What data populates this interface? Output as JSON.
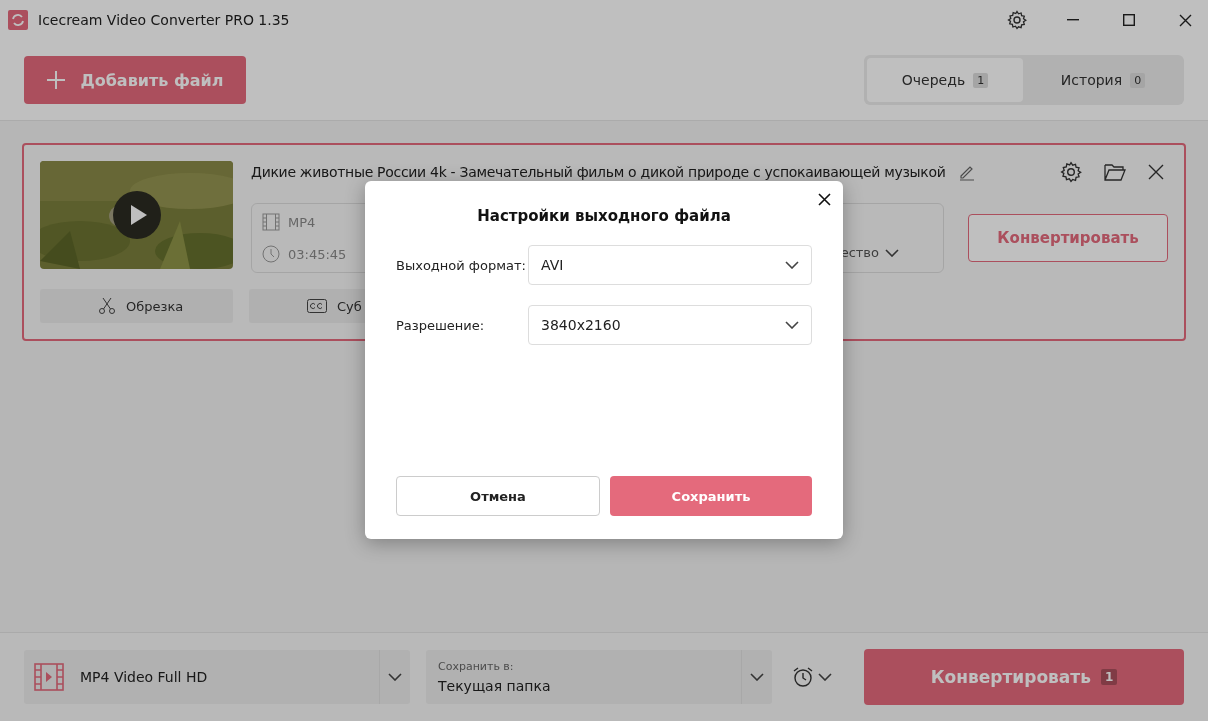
{
  "window": {
    "title": "Icecream Video Converter PRO 1.35"
  },
  "toolbar": {
    "add_button": "Добавить файл",
    "tabs": [
      {
        "label": "Очередь",
        "count": "1",
        "selected": true
      },
      {
        "label": "История",
        "count": "0",
        "selected": false
      }
    ]
  },
  "file_card": {
    "title": "Дикие животные России 4k - Замечательный фильм о дикой природе с успокаивающей музыкой",
    "format": "MP4",
    "duration": "03:45:45",
    "quality_fragment": "ество",
    "convert_button": "Конвертировать",
    "actions": [
      {
        "label": "Обрезка",
        "kind": "trim"
      },
      {
        "label": "Суб",
        "kind": "subtitles"
      }
    ]
  },
  "footer": {
    "preset": "MP4 Video Full HD",
    "save_to_label": "Сохранить в:",
    "save_to_value": "Текущая папка",
    "convert_button": "Конвертировать",
    "convert_count": "1"
  },
  "dialog": {
    "title": "Настройки выходного файла",
    "fields": [
      {
        "label": "Выходной формат:",
        "value": "AVI"
      },
      {
        "label": "Разрешение:",
        "value": "3840x2160"
      }
    ],
    "buttons": [
      {
        "label": "Отмена",
        "kind": "secondary"
      },
      {
        "label": "Сохранить",
        "kind": "primary"
      }
    ]
  }
}
